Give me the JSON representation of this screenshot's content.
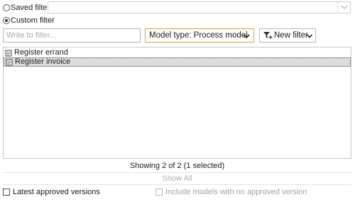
{
  "filter_mode": {
    "saved_filter_label": "Saved filter",
    "custom_filter_label": "Custom filter",
    "selected": "custom"
  },
  "saved_filter_select": {
    "value": ""
  },
  "filter_input": {
    "placeholder": "Write to filter...",
    "value": ""
  },
  "model_type": {
    "label": "Model type: Process model"
  },
  "new_filter": {
    "label": "New filter"
  },
  "list": {
    "items": [
      {
        "label": "Register errand",
        "selected": false
      },
      {
        "label": "Register invoice",
        "selected": true
      }
    ]
  },
  "status": {
    "text": "Showing 2 of 2 (1 selected)"
  },
  "show_all": {
    "label": "Show All"
  },
  "options": {
    "latest_approved_label": "Latest approved versions",
    "include_no_approved_label": "Include models with no approved version"
  },
  "colors": {
    "accent": "#e0a24a",
    "selected_row": "#dcdcdc"
  }
}
